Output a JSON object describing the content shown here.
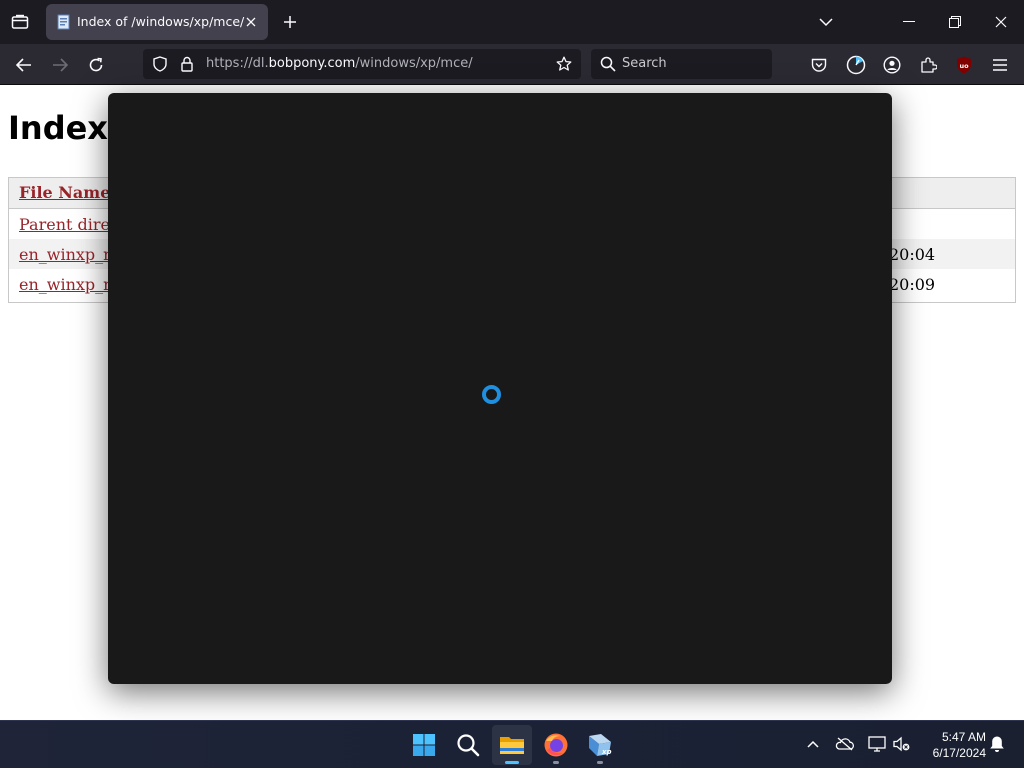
{
  "browser": {
    "tab": {
      "title": "Index of /windows/xp/mce/"
    },
    "url": {
      "prefix": "https://dl.",
      "host": "bobpony.com",
      "path": "/windows/xp/mce/"
    },
    "search": {
      "placeholder": "Search"
    }
  },
  "page": {
    "heading": "Index",
    "listing": {
      "header": {
        "file_name": "File Name"
      },
      "rows": [
        {
          "name": "Parent direc",
          "date": ""
        },
        {
          "name": "en_winxp_r",
          "date": "20:04"
        },
        {
          "name": "en_winxp_r",
          "date": "20:09"
        }
      ]
    }
  },
  "overlay": {
    "state": "loading",
    "spinner_color": "#1f8fe0"
  },
  "taskbar": {
    "apps": [
      "start-icon",
      "search-icon",
      "file-explorer-icon",
      "firefox-icon",
      "windows-xp-app-icon"
    ],
    "clock": {
      "time": "5:47 AM",
      "date": "6/17/2024"
    }
  },
  "colors": {
    "tab_strip": "#1c1b22",
    "nav_bar": "#2b2a33",
    "link": "#98242a",
    "overlay": "#191919"
  }
}
